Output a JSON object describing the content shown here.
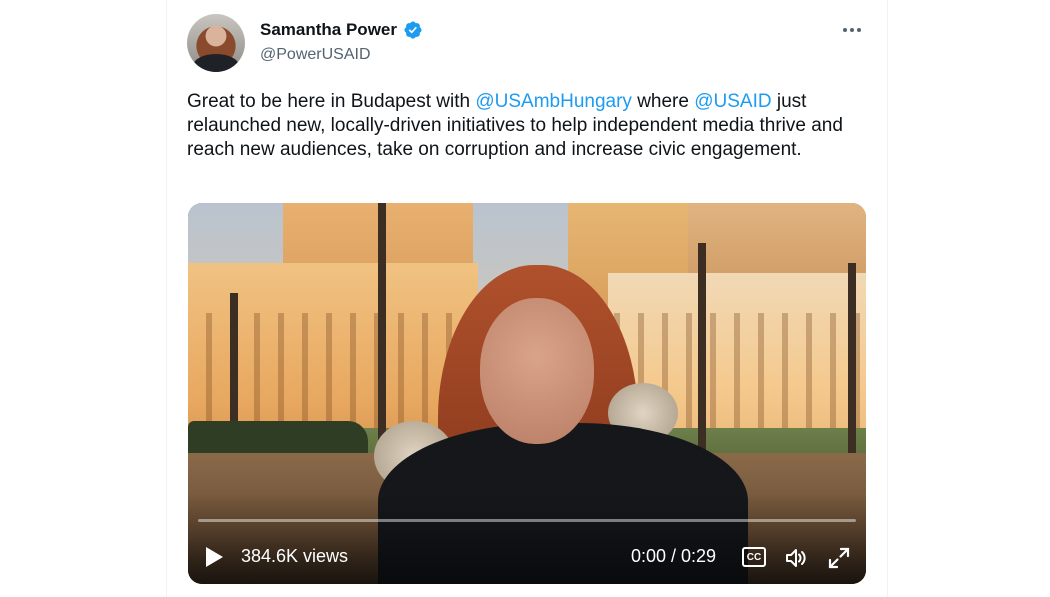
{
  "author": {
    "name": "Samantha Power",
    "handle": "@PowerUSAID",
    "verified": true,
    "verified_color": "#1d9bf0"
  },
  "menu": {
    "icon": "more-horizontal-icon"
  },
  "tweet": {
    "part1": "Great to be here in Budapest with ",
    "mention1": "@USAmbHungary",
    "part2": " where ",
    "mention2": "@USAID",
    "part3": " just relaunched new, locally-driven initiatives to help independent media thrive and reach new audiences, take on corruption and increase civic engagement."
  },
  "video": {
    "views": "384.6K views",
    "time": "0:00 / 0:29",
    "cc_label": "CC",
    "progress_fraction": 0.0,
    "accent": "#1d9bf0",
    "icons": [
      "play-icon",
      "closed-captions-icon",
      "volume-icon",
      "fullscreen-icon"
    ]
  }
}
